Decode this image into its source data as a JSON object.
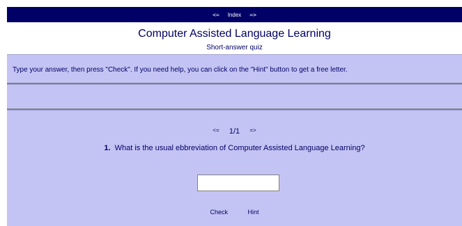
{
  "nav": {
    "prev": "<=",
    "index": "Index",
    "next": "=>"
  },
  "header": {
    "title": "Computer Assisted Language Learning",
    "subtitle": "Short-answer quiz"
  },
  "instructions": "Type your answer, then press \"Check\". If you need help, you can click on the \"Hint\" button to get a free letter.",
  "question_nav": {
    "prev": "<=",
    "counter": "1/1",
    "next": "=>"
  },
  "question": {
    "number": "1.",
    "text": "What is the usual ebbreviation of Computer Assisted Language Learning?",
    "answer_value": ""
  },
  "buttons": {
    "check": "Check",
    "hint": "Hint"
  },
  "colors": {
    "navbar": "#000066",
    "panel": "#c4c4f4",
    "text": "#000066"
  }
}
